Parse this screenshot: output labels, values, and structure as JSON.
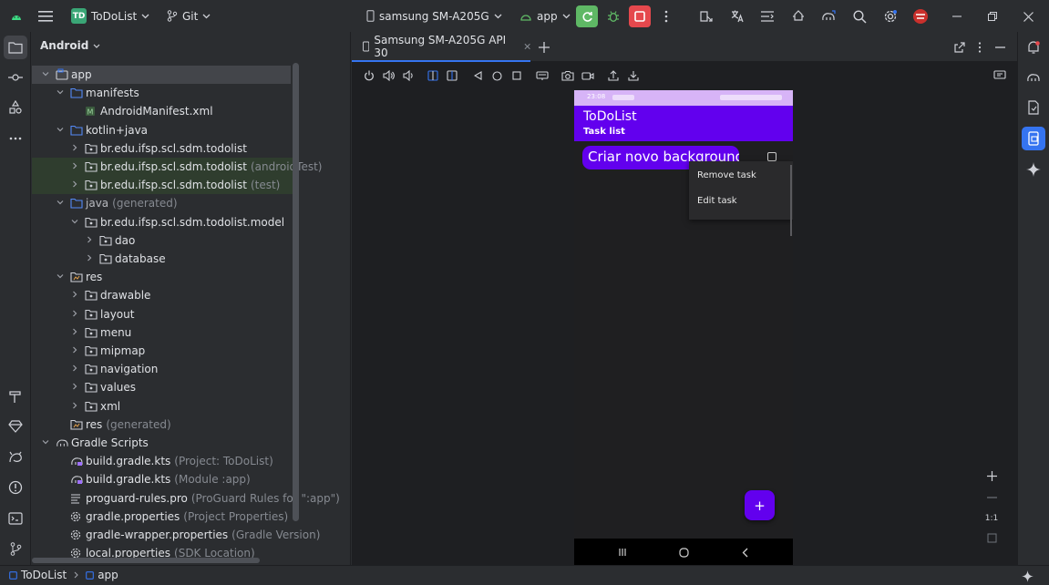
{
  "titlebar": {
    "logo_text": "TD",
    "project_name": "ToDoList",
    "vcs": "Git",
    "device": "samsung SM-A205G",
    "run_config": "app"
  },
  "project_panel": {
    "view": "Android",
    "tree": [
      {
        "label": "app",
        "hint": "",
        "indent": 0,
        "expanded": true,
        "icon": "module-icon",
        "selected": true
      },
      {
        "label": "manifests",
        "hint": "",
        "indent": 1,
        "expanded": true,
        "icon": "folder-icon"
      },
      {
        "label": "AndroidManifest.xml",
        "hint": "",
        "indent": 2,
        "leaf": true,
        "icon": "manifest-icon"
      },
      {
        "label": "kotlin+java",
        "hint": "",
        "indent": 1,
        "expanded": true,
        "icon": "folder-icon"
      },
      {
        "label": "br.edu.ifsp.scl.sdm.todolist",
        "hint": "",
        "indent": 2,
        "expanded": false,
        "icon": "package-icon"
      },
      {
        "label": "br.edu.ifsp.scl.sdm.todolist",
        "hint": "(androidTest)",
        "indent": 2,
        "expanded": false,
        "icon": "package-icon",
        "highlight": true
      },
      {
        "label": "br.edu.ifsp.scl.sdm.todolist",
        "hint": "(test)",
        "indent": 2,
        "expanded": false,
        "icon": "package-icon",
        "highlight": true
      },
      {
        "label": "java",
        "hint": "(generated)",
        "indent": 1,
        "expanded": true,
        "icon": "folder-icon",
        "dim": true
      },
      {
        "label": "br.edu.ifsp.scl.sdm.todolist.model",
        "hint": "",
        "indent": 2,
        "expanded": true,
        "icon": "package-icon"
      },
      {
        "label": "dao",
        "hint": "",
        "indent": 3,
        "expanded": false,
        "icon": "package-icon"
      },
      {
        "label": "database",
        "hint": "",
        "indent": 3,
        "expanded": false,
        "icon": "package-icon"
      },
      {
        "label": "res",
        "hint": "",
        "indent": 1,
        "expanded": true,
        "icon": "res-folder-icon"
      },
      {
        "label": "drawable",
        "hint": "",
        "indent": 2,
        "expanded": false,
        "icon": "package-icon"
      },
      {
        "label": "layout",
        "hint": "",
        "indent": 2,
        "expanded": false,
        "icon": "package-icon"
      },
      {
        "label": "menu",
        "hint": "",
        "indent": 2,
        "expanded": false,
        "icon": "package-icon"
      },
      {
        "label": "mipmap",
        "hint": "",
        "indent": 2,
        "expanded": false,
        "icon": "package-icon"
      },
      {
        "label": "navigation",
        "hint": "",
        "indent": 2,
        "expanded": false,
        "icon": "package-icon"
      },
      {
        "label": "values",
        "hint": "",
        "indent": 2,
        "expanded": false,
        "icon": "package-icon"
      },
      {
        "label": "xml",
        "hint": "",
        "indent": 2,
        "expanded": false,
        "icon": "package-icon"
      },
      {
        "label": "res",
        "hint": "(generated)",
        "indent": 1,
        "leaf": true,
        "icon": "res-folder-icon"
      },
      {
        "label": "Gradle Scripts",
        "hint": "",
        "indent": 0,
        "expanded": true,
        "icon": "gradle-icon"
      },
      {
        "label": "build.gradle.kts",
        "hint": "(Project: ToDoList)",
        "indent": 1,
        "leaf": true,
        "icon": "gradle-file-icon"
      },
      {
        "label": "build.gradle.kts",
        "hint": "(Module :app)",
        "indent": 1,
        "leaf": true,
        "icon": "gradle-file-icon"
      },
      {
        "label": "proguard-rules.pro",
        "hint": "(ProGuard Rules for \":app\")",
        "indent": 1,
        "leaf": true,
        "icon": "text-file-icon"
      },
      {
        "label": "gradle.properties",
        "hint": "(Project Properties)",
        "indent": 1,
        "leaf": true,
        "icon": "settings-file-icon"
      },
      {
        "label": "gradle-wrapper.properties",
        "hint": "(Gradle Version)",
        "indent": 1,
        "leaf": true,
        "icon": "settings-file-icon"
      },
      {
        "label": "local.properties",
        "hint": "(SDK Location)",
        "indent": 1,
        "leaf": true,
        "icon": "settings-file-icon"
      }
    ]
  },
  "emulator": {
    "tab_label": "Samsung SM-A205G API 30",
    "phone": {
      "status_time": "23:08",
      "app_title": "ToDoList",
      "app_subtitle": "Task list",
      "task_text": "Criar novo background",
      "context_menu": [
        "Remove task",
        "Edit task"
      ],
      "fab": "+",
      "zoom_ratio": "1:1"
    }
  },
  "statusbar": {
    "crumb_project": "ToDoList",
    "crumb_module": "app"
  },
  "colors": {
    "accent": "#3574f0",
    "app_purple": "#6200ee",
    "status_purple": "#d7b4f7",
    "run_green": "#5fb865",
    "stop_red": "#e5484d"
  }
}
